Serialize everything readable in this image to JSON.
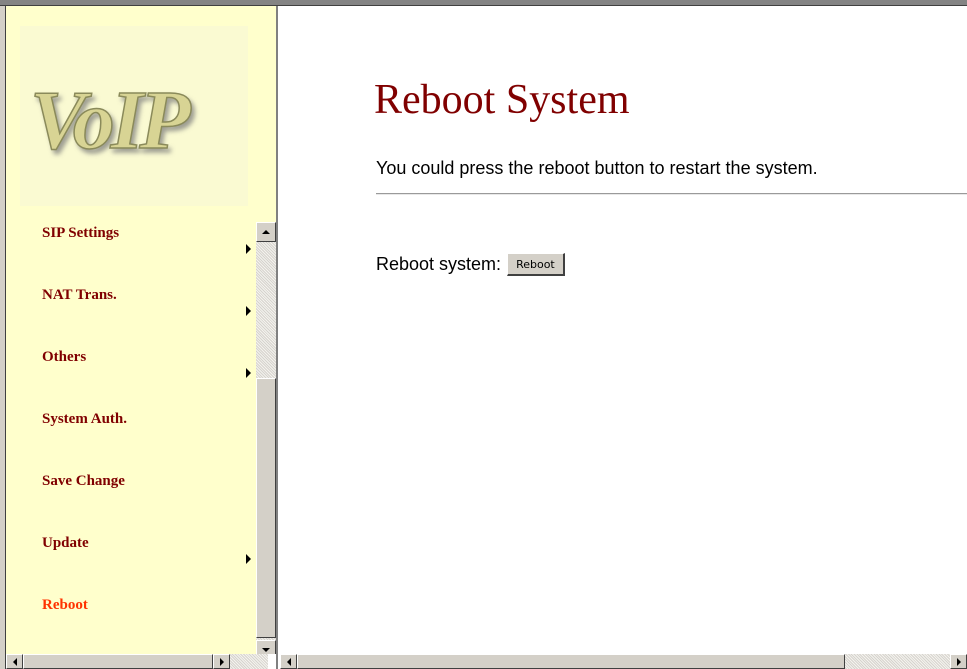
{
  "logo": {
    "text": "VoIP"
  },
  "nav": {
    "items": [
      {
        "label": "SIP Settings",
        "has_submenu": true,
        "active": false
      },
      {
        "label": "NAT Trans.",
        "has_submenu": true,
        "active": false
      },
      {
        "label": "Others",
        "has_submenu": true,
        "active": false
      },
      {
        "label": "System Auth.",
        "has_submenu": false,
        "active": false
      },
      {
        "label": "Save Change",
        "has_submenu": false,
        "active": false
      },
      {
        "label": "Update",
        "has_submenu": true,
        "active": false
      },
      {
        "label": "Reboot",
        "has_submenu": false,
        "active": true
      }
    ]
  },
  "main": {
    "title": "Reboot System",
    "description": "You could press the reboot button to restart the system.",
    "reboot_label": "Reboot system:",
    "reboot_button": "Reboot"
  },
  "colors": {
    "title": "#800000",
    "nav_text": "#800000",
    "nav_active": "#ff3300",
    "sidebar_bg": "#ffffcc"
  }
}
